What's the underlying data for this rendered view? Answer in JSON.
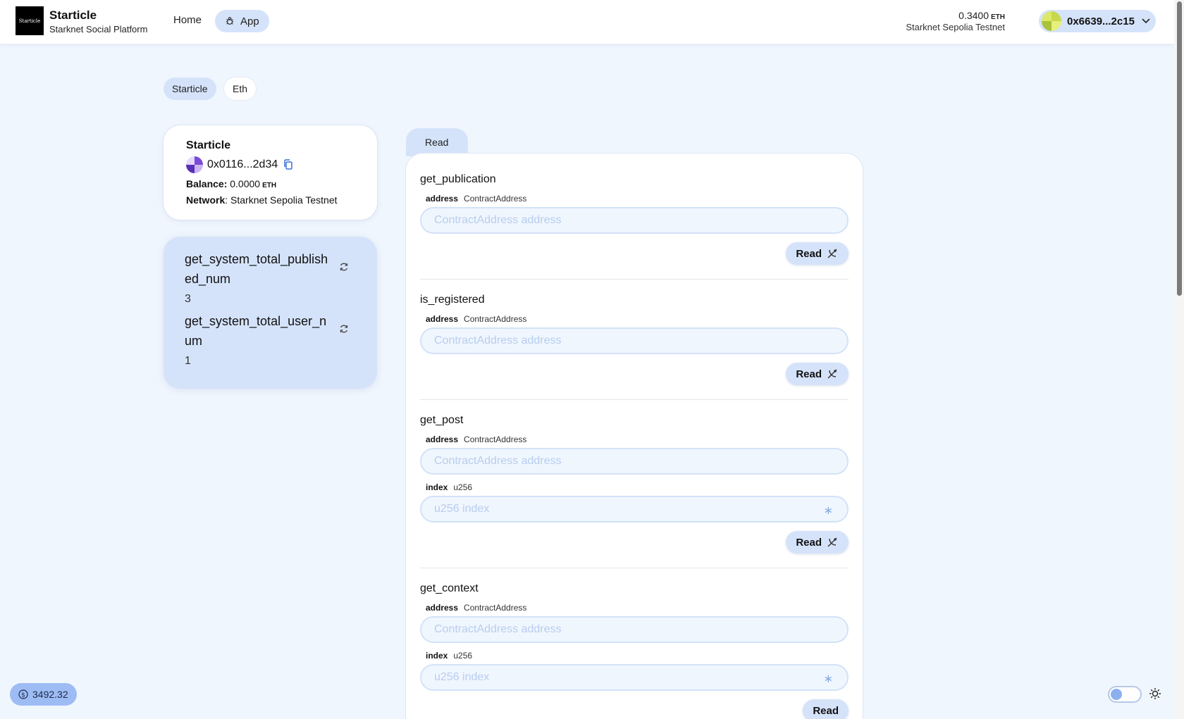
{
  "header": {
    "logo_text": "Starticle",
    "brand_title": "Starticle",
    "brand_subtitle": "Starknet Social Platform",
    "nav": {
      "home": "Home",
      "app": "App"
    },
    "balance_amount": "0.3400",
    "balance_unit": "ETH",
    "network": "Starknet Sepolia Testnet",
    "account_address": "0x6639...2c15"
  },
  "contract_tabs": [
    "Starticle",
    "Eth"
  ],
  "contract_info": {
    "name": "Starticle",
    "address": "0x0116...2d34",
    "balance_label": "Balance:",
    "balance_value": "0.0000",
    "balance_unit": "ETH",
    "network_label": "Network",
    "network_value": "Starknet Sepolia Testnet"
  },
  "variables": [
    {
      "name": "get_system_total_published_num",
      "value": "3"
    },
    {
      "name": "get_system_total_user_num",
      "value": "1"
    }
  ],
  "read_tab": "Read",
  "functions": [
    {
      "name": "get_publication",
      "params": [
        {
          "name": "address",
          "type": "ContractAddress",
          "placeholder": "ContractAddress address"
        }
      ],
      "button": "Read"
    },
    {
      "name": "is_registered",
      "params": [
        {
          "name": "address",
          "type": "ContractAddress",
          "placeholder": "ContractAddress address"
        }
      ],
      "button": "Read"
    },
    {
      "name": "get_post",
      "params": [
        {
          "name": "address",
          "type": "ContractAddress",
          "placeholder": "ContractAddress address"
        },
        {
          "name": "index",
          "type": "u256",
          "placeholder": "u256 index"
        }
      ],
      "button": "Read"
    },
    {
      "name": "get_context",
      "params": [
        {
          "name": "address",
          "type": "ContractAddress",
          "placeholder": "ContractAddress address"
        },
        {
          "name": "index",
          "type": "u256",
          "placeholder": "u256 index"
        }
      ],
      "button": "Read"
    }
  ],
  "footer": {
    "price": "3492.32"
  },
  "icons": {
    "nav_app": "bug-icon",
    "copy": "copy-icon",
    "refresh": "refresh-icon",
    "read_button": "satellite-icon",
    "price": "dollar-icon",
    "theme": "sun-icon"
  },
  "colors": {
    "accent_light": "#d5e3fa",
    "page_bg": "#f0f6fe",
    "input_border": "#d3e2f8",
    "price_badge": "#9ebcf4"
  }
}
